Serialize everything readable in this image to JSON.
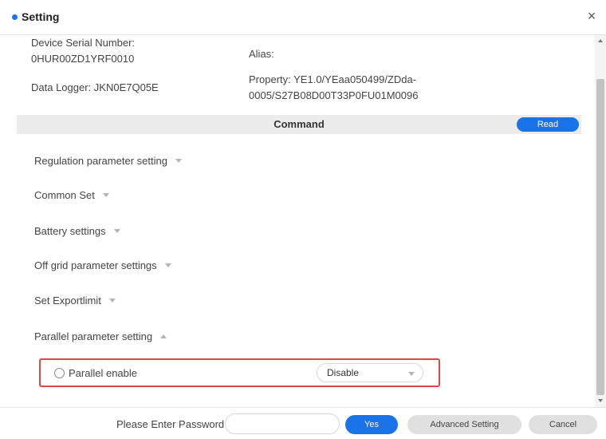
{
  "header": {
    "title": "Setting",
    "close_glyph": "×",
    "accent_color": "#1a73e8"
  },
  "device_info": {
    "serial_label": "Device Serial Number:",
    "serial_value": "0HUR00ZD1YRF0010",
    "logger_label": "Data Logger:",
    "logger_value": "JKN0E7Q05E",
    "alias_label": "Alias:",
    "alias_value": "",
    "property_label": "Property:",
    "property_value": "YE1.0/YEaa050499/ZDda-0005/S27B08D00T33P0FU01M0096"
  },
  "command": {
    "label": "Command",
    "read_button": "Read"
  },
  "sections": [
    {
      "label": "Regulation parameter setting",
      "expanded": false
    },
    {
      "label": "Common Set",
      "expanded": false
    },
    {
      "label": "Battery settings",
      "expanded": false
    },
    {
      "label": "Off grid parameter settings",
      "expanded": false
    },
    {
      "label": "Set Exportlimit",
      "expanded": false
    },
    {
      "label": "Parallel parameter setting",
      "expanded": true
    }
  ],
  "parallel": {
    "radio_label": "Parallel enable",
    "radio_checked": false,
    "select_value": "Disable",
    "highlight_color": "#e04848"
  },
  "footer": {
    "password_label": "Please Enter Password",
    "password_value": "",
    "password_placeholder": "",
    "yes_button": "Yes",
    "advanced_button": "Advanced Setting",
    "cancel_button": "Cancel"
  }
}
